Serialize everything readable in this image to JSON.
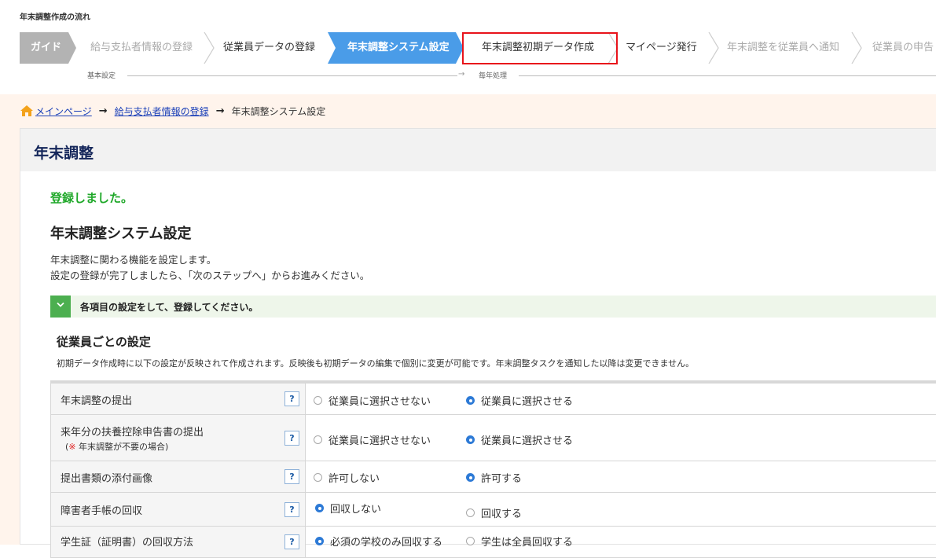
{
  "flow": {
    "title": "年末調整作成の流れ",
    "steps": [
      {
        "label": "ガイド"
      },
      {
        "label": "給与支払者情報の登録"
      },
      {
        "label": "従業員データの登録"
      },
      {
        "label": "年末調整システム設定"
      },
      {
        "label": "年末調整初期データ作成"
      },
      {
        "label": "マイページ発行"
      },
      {
        "label": "年末調整を従業員へ通知"
      },
      {
        "label": "従業員の申告"
      }
    ],
    "phase_basic": "基本設定",
    "phase_yearly": "毎年処理"
  },
  "breadcrumb": {
    "home": "メインページ",
    "payer": "給与支払者情報の登録",
    "current": "年末調整システム設定"
  },
  "panel": {
    "title": "年末調整",
    "success": "登録しました。",
    "heading": "年末調整システム設定",
    "desc1": "年末調整に関わる機能を設定します。",
    "desc2": "設定の登録が完了しましたら、「次のステップへ」からお進みください。",
    "notice": "各項目の設定をして、登録してください。",
    "section_title": "従業員ごとの設定",
    "section_note": "初期データ作成時に以下の設定が反映されて作成されます。反映後も初期データの編集で個別に変更が可能です。年末調整タスクを通知した以降は変更できません。"
  },
  "settings": {
    "help_mark": "?",
    "rows": [
      {
        "label": "年末調整の提出",
        "opt1": "従業員に選択させない",
        "opt2": "従業員に選択させる",
        "selected": 2
      },
      {
        "label": "来年分の扶養控除申告書の提出",
        "note_mark": "※",
        "note": "年末調整が不要の場合",
        "opt1": "従業員に選択させない",
        "opt2": "従業員に選択させる",
        "selected": 2
      },
      {
        "label": "提出書類の添付画像",
        "opt1": "許可しない",
        "opt2": "許可する",
        "selected": 2
      },
      {
        "label": "障害者手帳の回収",
        "opt1": "回収しない",
        "opt2": "回収する",
        "selected": 1
      },
      {
        "label": "学生証（証明書）の回収方法",
        "opt1": "必須の学校のみ回収する",
        "opt2": "学生は全員回収する",
        "selected": 1
      }
    ]
  },
  "colors": {
    "active_step": "#4a9ce8",
    "highlight": "#e8131b",
    "success": "#1fa829",
    "radio_on": "#2d7ad6"
  }
}
